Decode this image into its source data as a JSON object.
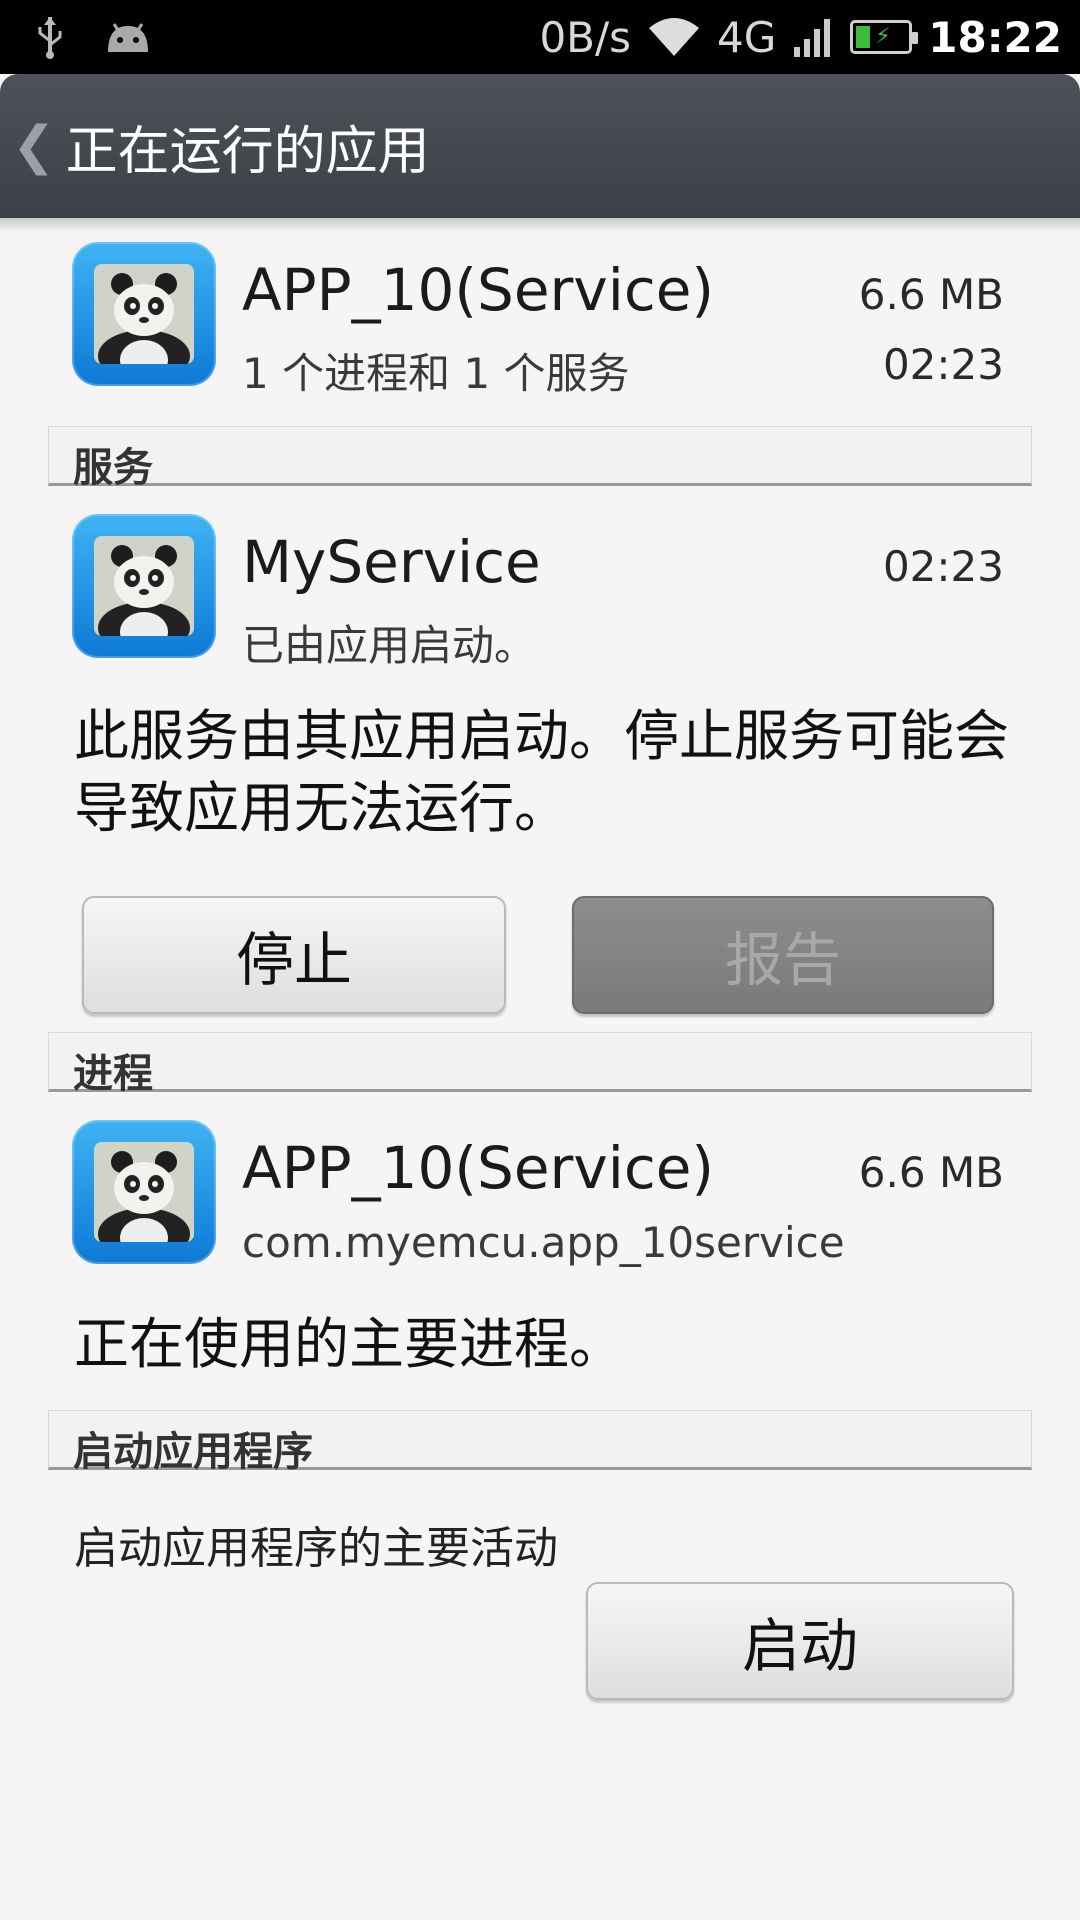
{
  "status_bar": {
    "net_speed": "0B/s",
    "network": "4G",
    "time": "18:22",
    "icons": [
      "usb-icon",
      "android-debug-icon",
      "wifi-icon",
      "signal-icon",
      "battery-charging-icon"
    ]
  },
  "action_bar": {
    "back_glyph": "❮",
    "title": "正在运行的应用"
  },
  "app_header": {
    "name": "APP_10(Service)",
    "summary": "1 个进程和 1 个服务",
    "size": "6.6 MB",
    "time": "02:23"
  },
  "services_section": {
    "header": "服务",
    "item": {
      "name": "MyService",
      "status": "已由应用启动。",
      "time": "02:23"
    },
    "description": "此服务由其应用启动。停止服务可能会导致应用无法运行。",
    "stop_button": "停止",
    "report_button": "报告"
  },
  "process_section": {
    "header": "进程",
    "item": {
      "name": "APP_10(Service)",
      "package": "com.myemcu.app_10service",
      "size": "6.6 MB"
    },
    "description": "正在使用的主要进程。"
  },
  "launch_section": {
    "header": "启动应用程序",
    "description": "启动应用程序的主要活动",
    "launch_button": "启动"
  },
  "colors": {
    "action_bar": "#43474e",
    "background": "#f5f5f5",
    "icon_blue": "#1a8fe3",
    "disabled_button": "#848484"
  }
}
